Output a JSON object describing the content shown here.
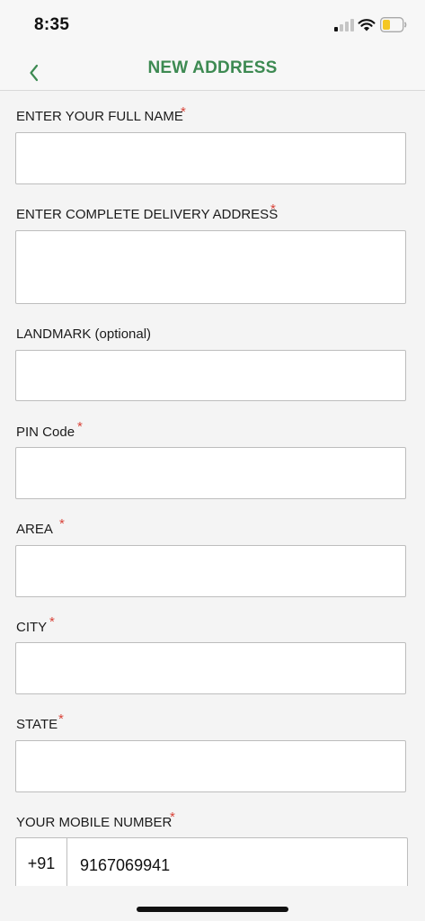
{
  "status_bar": {
    "time": "8:35"
  },
  "header": {
    "title": "NEW ADDRESS"
  },
  "form": {
    "full_name": {
      "label": "ENTER YOUR FULL NAME",
      "required_mark": "*",
      "value": ""
    },
    "delivery_address": {
      "label": "ENTER COMPLETE DELIVERY ADDRESS",
      "required_mark": "*",
      "value": ""
    },
    "landmark": {
      "label": "LANDMARK (optional)",
      "value": ""
    },
    "pin_code": {
      "label": "PIN Code",
      "required_mark": "*",
      "value": ""
    },
    "area": {
      "label": "AREA",
      "required_mark": "*",
      "value": ""
    },
    "city": {
      "label": "CITY",
      "required_mark": "*",
      "value": ""
    },
    "state": {
      "label": "STATE",
      "required_mark": "*",
      "value": ""
    },
    "mobile": {
      "label": "YOUR MOBILE NUMBER",
      "required_mark": "*",
      "country_code": "+91",
      "value": "9167069941"
    }
  },
  "colors": {
    "accent": "#3d8a52",
    "required": "#d9443a",
    "background": "#f4f4f4"
  },
  "icons": {
    "back": "chevron-left-icon",
    "signal": "cellular-signal-icon",
    "wifi": "wifi-icon",
    "battery": "battery-low-icon"
  }
}
